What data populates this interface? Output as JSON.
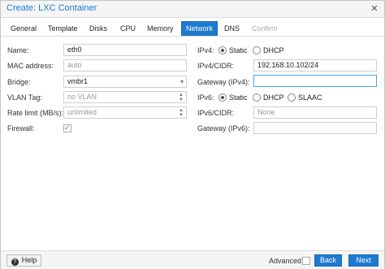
{
  "window": {
    "title": "Create: LXC Container"
  },
  "tabs": [
    {
      "label": "General"
    },
    {
      "label": "Template"
    },
    {
      "label": "Disks"
    },
    {
      "label": "CPU"
    },
    {
      "label": "Memory"
    },
    {
      "label": "Network"
    },
    {
      "label": "DNS"
    },
    {
      "label": "Confirm"
    }
  ],
  "active_tab": "Network",
  "left": {
    "name_label": "Name:",
    "name_value": "eth0",
    "mac_label": "MAC address:",
    "mac_placeholder": "auto",
    "bridge_label": "Bridge:",
    "bridge_value": "vmbr1",
    "vlan_label": "VLAN Tag:",
    "vlan_placeholder": "no VLAN",
    "rate_label": "Rate limit (MB/s):",
    "rate_placeholder": "unlimited",
    "firewall_label": "Firewall:",
    "firewall_checked": true
  },
  "right": {
    "ipv4_label": "IPv4:",
    "ipv4_static": "Static",
    "ipv4_dhcp": "DHCP",
    "ipv4_mode": "Static",
    "ipv4cidr_label": "IPv4/CIDR:",
    "ipv4cidr_value": "192.168.10.102/24",
    "gw4_label": "Gateway (IPv4):",
    "gw4_value": "",
    "ipv6_label": "IPv6:",
    "ipv6_static": "Static",
    "ipv6_dhcp": "DHCP",
    "ipv6_slaac": "SLAAC",
    "ipv6_mode": "Static",
    "ipv6cidr_label": "IPv6/CIDR:",
    "ipv6cidr_placeholder": "None",
    "gw6_label": "Gateway (IPv6):",
    "gw6_value": ""
  },
  "footer": {
    "help_label": "Help",
    "advanced_label": "Advanced",
    "back_label": "Back",
    "next_label": "Next"
  },
  "colors": {
    "accent": "#1e7ad0",
    "focus_border": "#4aa3f0"
  }
}
